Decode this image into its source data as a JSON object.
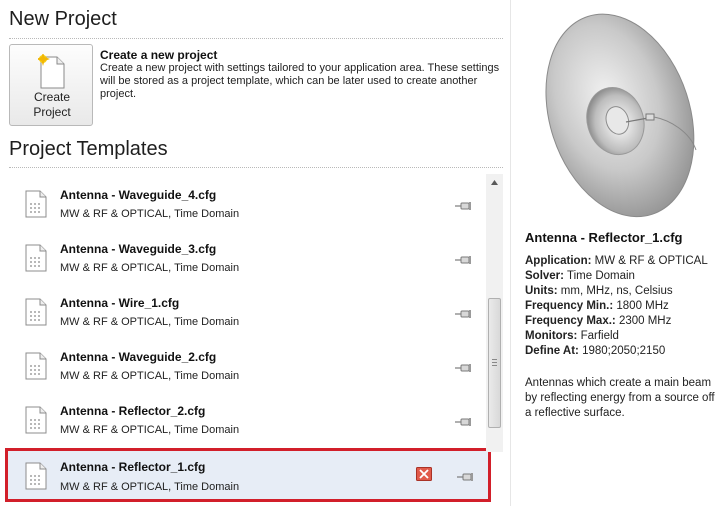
{
  "new_project": {
    "title": "New Project",
    "create_button": {
      "line1": "Create",
      "line2": "Project"
    },
    "create_heading": "Create a new project",
    "create_description": "Create a new project with settings tailored to your application area. These settings will be stored as a project template, which can be later used to create another project."
  },
  "templates": {
    "title": "Project Templates",
    "items": [
      {
        "name": "Antenna - Waveguide_4.cfg",
        "sub": "MW & RF & OPTICAL, Time Domain"
      },
      {
        "name": "Antenna - Waveguide_3.cfg",
        "sub": "MW & RF & OPTICAL, Time Domain"
      },
      {
        "name": "Antenna - Wire_1.cfg",
        "sub": "MW & RF & OPTICAL, Time Domain"
      },
      {
        "name": "Antenna - Waveguide_2.cfg",
        "sub": "MW & RF & OPTICAL, Time Domain"
      },
      {
        "name": "Antenna - Reflector_2.cfg",
        "sub": "MW & RF & OPTICAL, Time Domain"
      },
      {
        "name": "Antenna - Reflector_1.cfg",
        "sub": "MW & RF & OPTICAL, Time Domain"
      }
    ],
    "selected_index": 5
  },
  "details": {
    "title": "Antenna - Reflector_1.cfg",
    "properties": [
      {
        "label": "Application:",
        "value": "MW & RF & OPTICAL"
      },
      {
        "label": "Solver:",
        "value": "Time Domain"
      },
      {
        "label": "Units:",
        "value": "mm, MHz, ns, Celsius"
      },
      {
        "label": "Frequency Min.:",
        "value": "1800 MHz"
      },
      {
        "label": "Frequency Max.:",
        "value": "2300 MHz"
      },
      {
        "label": "Monitors:",
        "value": "Farfield"
      },
      {
        "label": "Define At:",
        "value": "1980;2050;2150"
      }
    ],
    "description": "Antennas which create a main beam by reflecting energy from a source off a reflective surface."
  },
  "icons": {
    "template_file": "cfg-file-icon",
    "pin": "pin-icon",
    "remove": "remove-template-icon",
    "new_doc": "new-document-icon"
  },
  "colors": {
    "selection_border": "#d21f2a",
    "selection_fill": "#e7edf6",
    "remove_icon": "#c0392b"
  }
}
